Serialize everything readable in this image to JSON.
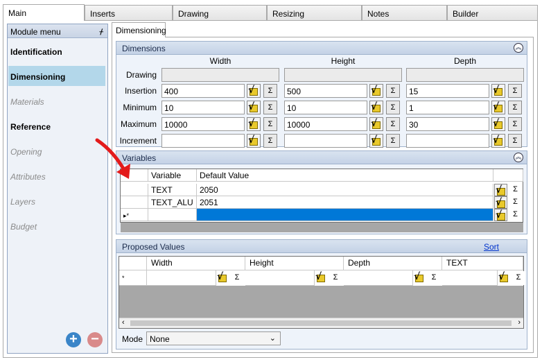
{
  "top_tabs": [
    "Main",
    "Inserts",
    "Drawing",
    "Resizing",
    "Notes",
    "Builder"
  ],
  "module_menu": {
    "title": "Module menu",
    "items": [
      {
        "label": "Identification",
        "state": "bold"
      },
      {
        "label": "Dimensioning",
        "state": "selected"
      },
      {
        "label": "Materials",
        "state": "disabled"
      },
      {
        "label": "Reference",
        "state": "bold"
      },
      {
        "label": "Opening",
        "state": "disabled"
      },
      {
        "label": "Attributes",
        "state": "disabled"
      },
      {
        "label": "Layers",
        "state": "disabled"
      },
      {
        "label": "Budget",
        "state": "disabled"
      }
    ],
    "add_symbol": "+",
    "remove_symbol": "−"
  },
  "sub_tab": "Dimensioning",
  "dimensions": {
    "title": "Dimensions",
    "columns": [
      "Width",
      "Height",
      "Depth"
    ],
    "rows": {
      "drawing": {
        "label": "Drawing"
      },
      "insertion": {
        "label": "Insertion",
        "values": [
          "400",
          "500",
          "15"
        ]
      },
      "minimum": {
        "label": "Minimum",
        "values": [
          "10",
          "10",
          "1"
        ]
      },
      "maximum": {
        "label": "Maximum",
        "values": [
          "10000",
          "10000",
          "30"
        ]
      },
      "increment": {
        "label": "Increment",
        "values": [
          "",
          "",
          ""
        ]
      }
    }
  },
  "variables": {
    "title": "Variables",
    "headers": [
      "Variable",
      "Default Value"
    ],
    "rows": [
      {
        "name": "TEXT",
        "value": "2050"
      },
      {
        "name": "TEXT_ALU",
        "value": "2051"
      }
    ],
    "new_row_marker": "▸*"
  },
  "proposed": {
    "title": "Proposed Values",
    "sort_label": "Sort",
    "headers": [
      "Width",
      "Height",
      "Depth",
      "TEXT"
    ],
    "new_row_marker": "*"
  },
  "mode": {
    "label": "Mode",
    "value": "None"
  },
  "symbols": {
    "sigma": "Σ",
    "collapse": "︽",
    "pin": "📌"
  },
  "colors": {
    "selection": "#0078d7",
    "section_header": "#c4d2e6",
    "arrow": "#e31b1b"
  }
}
